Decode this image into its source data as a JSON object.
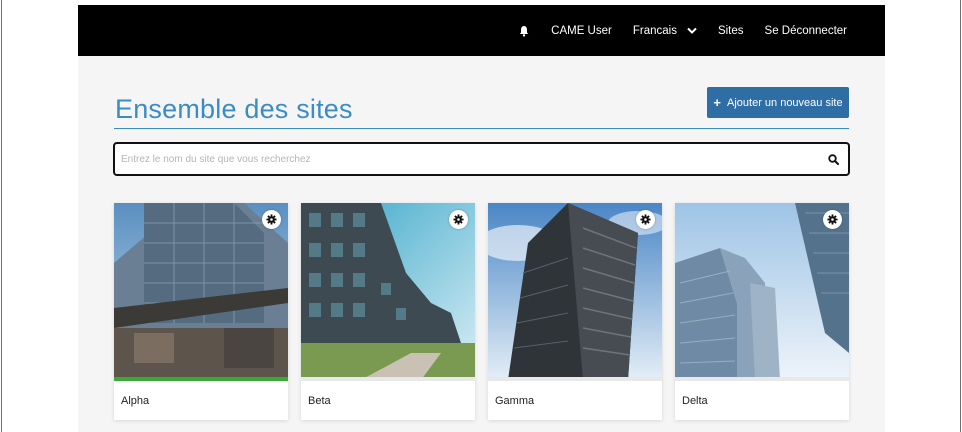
{
  "header": {
    "user_name": "CAME User",
    "language": "Francais",
    "sites_link": "Sites",
    "logout_link": "Se Déconnecter"
  },
  "main": {
    "page_title": "Ensemble des sites",
    "add_site_button": "Ajouter un nouveau site",
    "search_placeholder": "Entrez le nom du site que vous recherchez"
  },
  "sites": [
    {
      "name": "Alpha",
      "status_color": "#3aaa35"
    },
    {
      "name": "Beta",
      "status_color": "#e8e8e8"
    },
    {
      "name": "Gamma",
      "status_color": "#e8e8e8"
    },
    {
      "name": "Delta",
      "status_color": "#e8e8e8"
    }
  ],
  "colors": {
    "accent": "#3a8cc7",
    "button": "#2f6ea5",
    "topbar": "#000000"
  }
}
